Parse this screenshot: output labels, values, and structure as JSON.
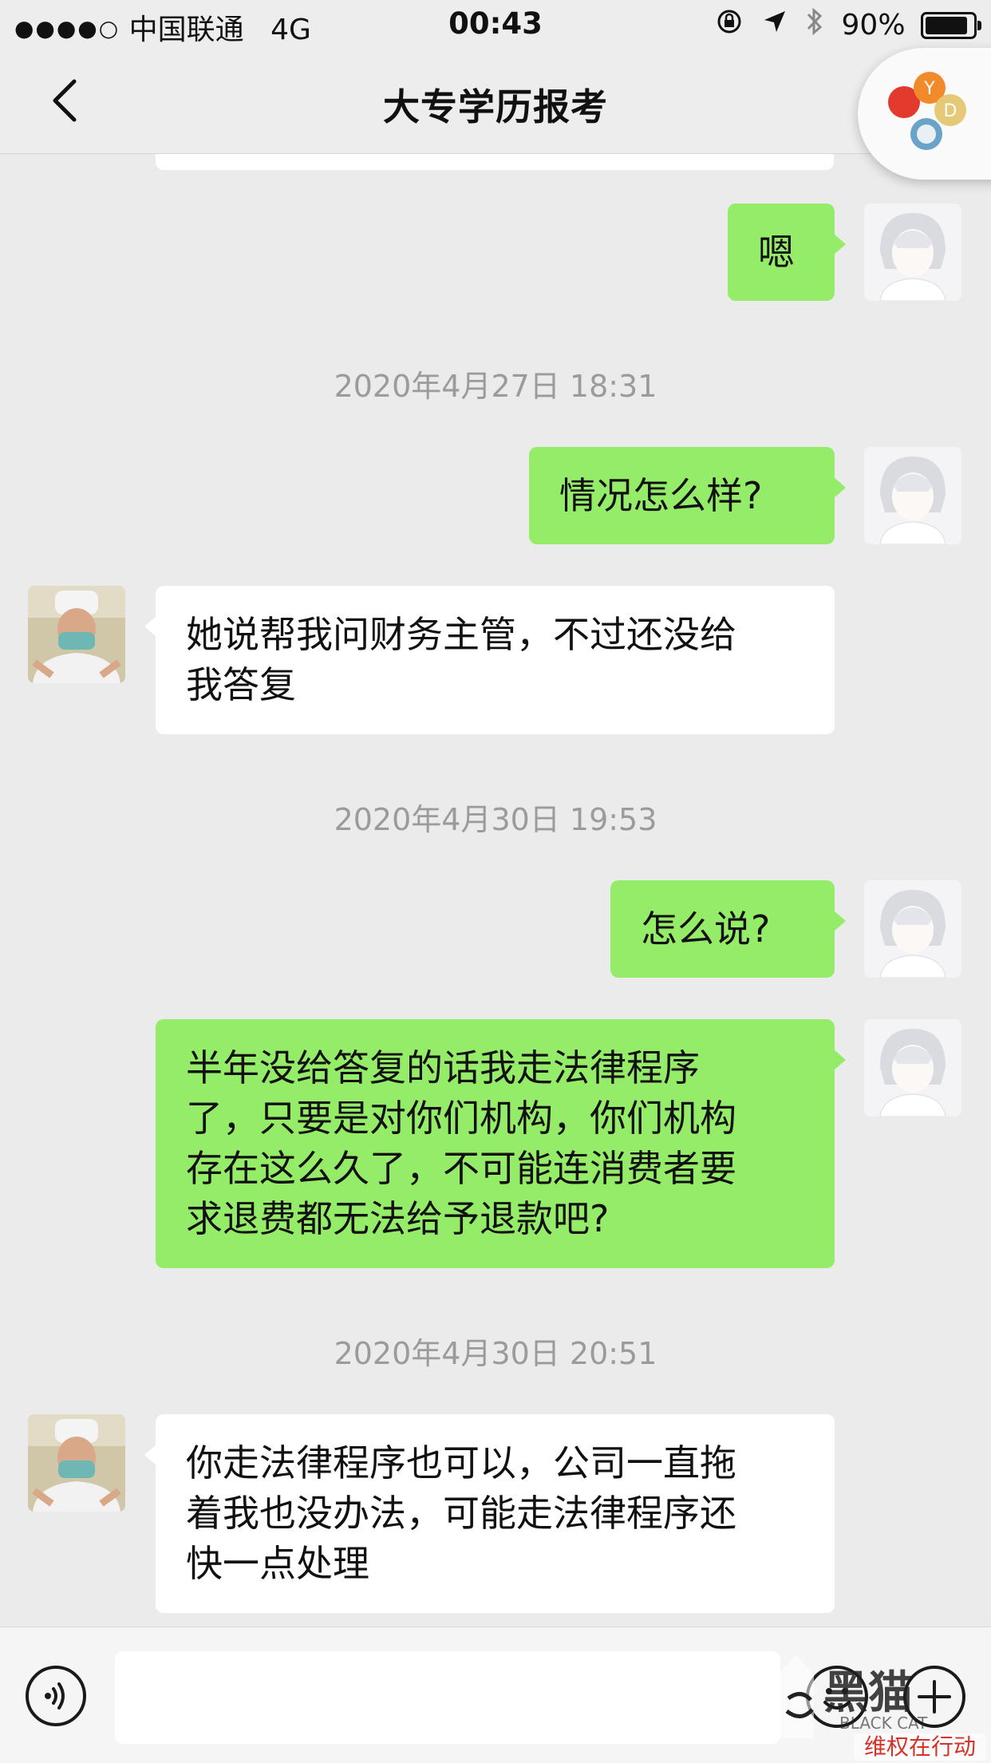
{
  "status_bar": {
    "carrier": "中国联通",
    "network": "4G",
    "time": "00:43",
    "battery": "90%"
  },
  "nav": {
    "title": "大专学历报考"
  },
  "messages": [
    {
      "side": "me",
      "text": "嗯"
    },
    {
      "timestamp": "2020年4月27日 18:31"
    },
    {
      "side": "me",
      "text": "情况怎么样?"
    },
    {
      "side": "them",
      "lines": [
        "她说帮我问财务主管，不过还没给",
        "我答复"
      ]
    },
    {
      "timestamp": "2020年4月30日 19:53"
    },
    {
      "side": "me",
      "text": "怎么说?"
    },
    {
      "side": "me",
      "lines": [
        "半年没给答复的话我走法律程序",
        "了，只要是对你们机构，你们机构",
        "存在这么久了，不可能连消费者要",
        "求退费都无法给予退款吧?"
      ]
    },
    {
      "timestamp": "2020年4月30日 20:51"
    },
    {
      "side": "them",
      "lines": [
        "你走法律程序也可以，公司一直拖",
        "着我也没办法，可能走法律程序还",
        "快一点处理"
      ]
    }
  ],
  "watermark": {
    "text": "维权在行动",
    "brand": "BLACK CAT"
  },
  "colors": {
    "my_bubble": "#95ec69",
    "their_bubble": "#ffffff",
    "background": "#ebebeb",
    "timestamp_text": "#9b9b9b"
  },
  "icons": [
    "back-chevron-icon",
    "mini-program-icon",
    "voice-icon",
    "emoji-icon",
    "plus-icon",
    "location-arrow-icon",
    "bluetooth-icon",
    "rotation-lock-icon"
  ]
}
